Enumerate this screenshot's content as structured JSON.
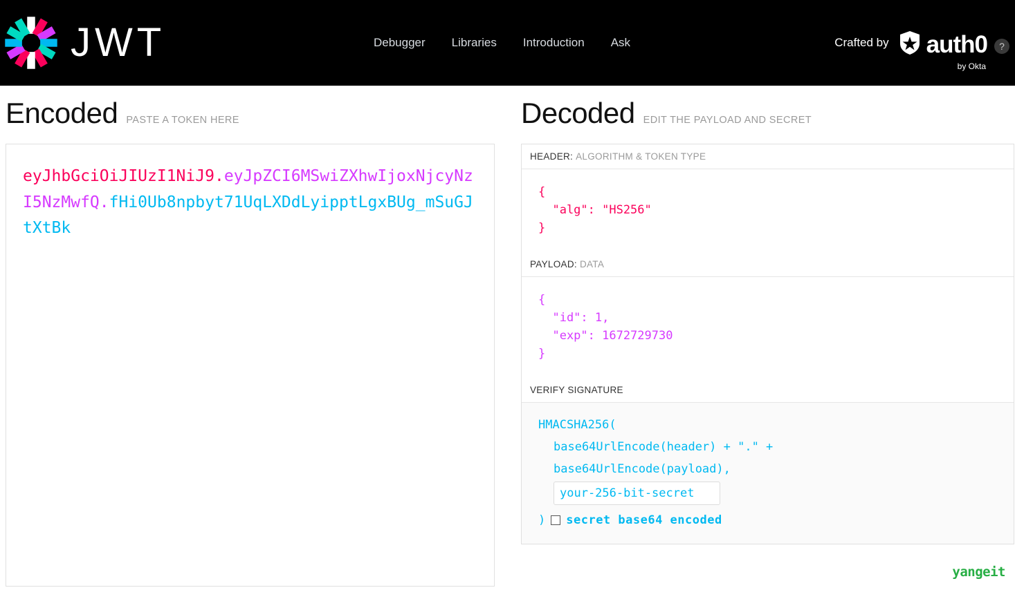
{
  "brand": {
    "wordmark": "JWT",
    "logo_icon": "jwt-starburst-logo",
    "logo_colors": [
      "#00d9c0",
      "#fb015b",
      "#d63aff",
      "#00b9f1",
      "#ffffff"
    ]
  },
  "nav": {
    "items": [
      {
        "label": "Debugger"
      },
      {
        "label": "Libraries"
      },
      {
        "label": "Introduction"
      },
      {
        "label": "Ask"
      }
    ]
  },
  "crafted": {
    "label": "Crafted by",
    "company": "auth0",
    "sub": "by Okta",
    "help_icon": "question-mark-icon",
    "help_glyph": "?"
  },
  "encoded": {
    "title": "Encoded",
    "hint": "PASTE A TOKEN HERE",
    "token": {
      "header": "eyJhbGciOiJIUzI1NiJ9",
      "dot1": ".",
      "payload": "eyJpZCI6MSwiZXhwIjoxNjcyNzI5NzMwfQ",
      "dot2": ".",
      "signature": "fHi0Ub8npbyt71UqLXDdLyipptLgxBUg_mSuGJtXtBk",
      "full": "eyJhbGciOiJIUzI1NiJ9.eyJpZCI6MSwiZXhwIjoxNjcyNzI5NzMwfQ.fHi0Ub8npbyt71UqLXDdLyipptLgxBUg_mSuGJtXtBk"
    },
    "colors": {
      "header": "#fb015b",
      "payload": "#d63aff",
      "signature": "#00b9f1"
    }
  },
  "decoded": {
    "title": "Decoded",
    "hint": "EDIT THE PAYLOAD AND SECRET",
    "sections": {
      "header": {
        "label_key": "HEADER:",
        "label_value": "ALGORITHM & TOKEN TYPE",
        "json": "{\n  \"alg\": \"HS256\"\n}",
        "fields": [
          {
            "key": "alg",
            "value": "HS256"
          }
        ]
      },
      "payload": {
        "label_key": "PAYLOAD:",
        "label_value": "DATA",
        "json": "{\n  \"id\": 1,\n  \"exp\": 1672729730\n}",
        "fields": [
          {
            "key": "id",
            "value": "1"
          },
          {
            "key": "exp",
            "value": "1672729730"
          }
        ]
      },
      "signature": {
        "label_key": "VERIFY SIGNATURE",
        "label_value": "",
        "line1": "HMACSHA256(",
        "line2": "base64UrlEncode(header) + \".\" +",
        "line3": "base64UrlEncode(payload),",
        "secret_value": "your-256-bit-secret",
        "secret_placeholder": "your-256-bit-secret",
        "closing_paren": ")",
        "checkbox_label": "secret base64 encoded",
        "checkbox_checked": false
      }
    }
  },
  "watermark": {
    "text": "yangeit",
    "color": "#27ae44"
  }
}
